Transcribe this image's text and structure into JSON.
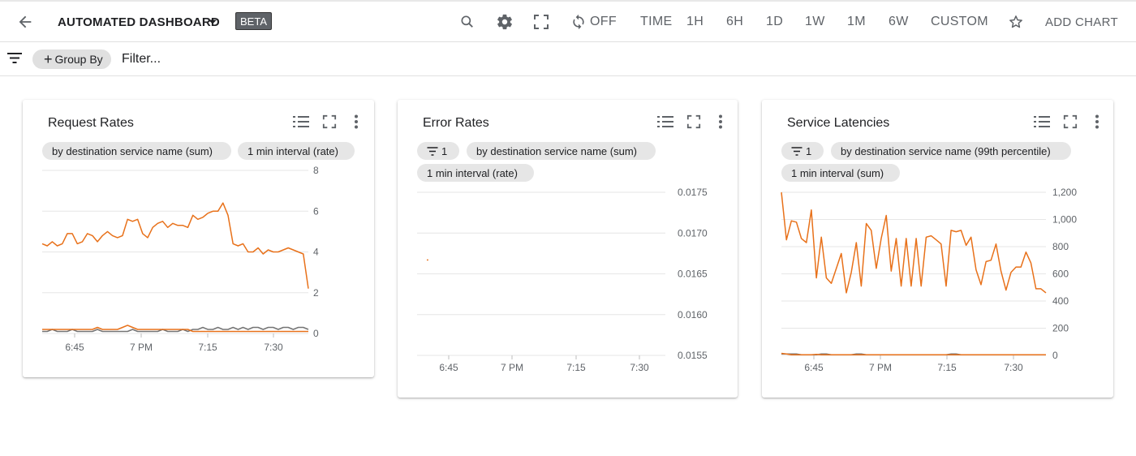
{
  "toolbar": {
    "title": "AUTOMATED DASHBOARD",
    "badge": "BETA",
    "refresh_label": "OFF",
    "time_label": "TIME",
    "ranges": [
      "1H",
      "6H",
      "1D",
      "1W",
      "1M",
      "6W",
      "CUSTOM"
    ],
    "add_chart_label": "ADD CHART",
    "icons": [
      "back-arrow-icon",
      "caret-down-icon",
      "search-icon",
      "gear-icon",
      "fullscreen-icon",
      "refresh-icon",
      "star-icon"
    ]
  },
  "filterbar": {
    "group_by_label": "Group By",
    "filter_placeholder": "Filter..."
  },
  "cards": [
    {
      "title": "Request Rates",
      "chips": [
        "by destination service name (sum)",
        "1 min interval (rate)"
      ]
    },
    {
      "title": "Error Rates",
      "filter_chip": "1",
      "chips": [
        "by destination service name (sum)",
        "1 min interval (rate)"
      ]
    },
    {
      "title": "Service Latencies",
      "filter_chip": "1",
      "chips": [
        "by destination service name (99th percentile)",
        "1 min interval (sum)"
      ]
    }
  ],
  "chart_data": [
    {
      "type": "line",
      "title": "Request Rates",
      "x_ticks": [
        "6:45",
        "7 PM",
        "7:15",
        "7:30"
      ],
      "y_ticks": [
        "0",
        "2",
        "4",
        "6",
        "8"
      ],
      "ylim": [
        0,
        8
      ],
      "grid": true,
      "series": [
        {
          "color": "#e8711a",
          "values": [
            4.4,
            4.3,
            4.5,
            4.3,
            4.4,
            4.9,
            4.9,
            4.4,
            4.5,
            4.9,
            4.8,
            4.5,
            4.8,
            5.0,
            4.8,
            4.7,
            4.8,
            5.6,
            5.5,
            5.6,
            4.9,
            4.7,
            5.2,
            5.4,
            5.5,
            5.2,
            5.4,
            5.3,
            5.3,
            5.2,
            5.8,
            5.6,
            5.7,
            5.9,
            6.0,
            6.0,
            6.4,
            5.8,
            4.4,
            4.3,
            4.4,
            4.0,
            4.0,
            4.2,
            3.9,
            4.1,
            4.0,
            4.0,
            4.1,
            4.2,
            4.1,
            4.0,
            3.9,
            2.2
          ]
        },
        {
          "color": "#757575",
          "values": [
            0.1,
            0.1,
            0.2,
            0.1,
            0.1,
            0.1,
            0.2,
            0.1,
            0.1,
            0.1,
            0.1,
            0.2,
            0.1,
            0.1,
            0.1,
            0.1,
            0.1,
            0.1,
            0.2,
            0.1,
            0.1,
            0.1,
            0.1,
            0.1,
            0.2,
            0.1,
            0.1,
            0.1,
            0.2,
            0.1,
            0.2,
            0.2,
            0.3,
            0.2,
            0.2,
            0.3,
            0.2,
            0.2,
            0.3,
            0.2,
            0.3,
            0.2,
            0.3,
            0.3,
            0.2,
            0.3,
            0.3,
            0.2,
            0.3,
            0.3,
            0.2,
            0.3,
            0.3,
            0.2
          ]
        },
        {
          "color": "#e8711a",
          "values": [
            0.2,
            0.2,
            0.2,
            0.2,
            0.2,
            0.2,
            0.2,
            0.2,
            0.2,
            0.2,
            0.2,
            0.3,
            0.2,
            0.2,
            0.2,
            0.2,
            0.3,
            0.4,
            0.3,
            0.2,
            0.2,
            0.2,
            0.2,
            0.2,
            0.2,
            0.2,
            0.2,
            0.2,
            0.2,
            0.2,
            0.1,
            0.1,
            0.1,
            0.1,
            0.1,
            0.1,
            0.1,
            0.1,
            0.1,
            0.1,
            0.1,
            0.1,
            0.1,
            0.1,
            0.1,
            0.1,
            0.1,
            0.1,
            0.1,
            0.1,
            0.1,
            0.1,
            0.1,
            0.1
          ]
        }
      ]
    },
    {
      "type": "line",
      "title": "Error Rates",
      "x_ticks": [
        "6:45",
        "7 PM",
        "7:15",
        "7:30"
      ],
      "y_ticks": [
        "0.0155",
        "0.0160",
        "0.0165",
        "0.0170",
        "0.0175"
      ],
      "ylim": [
        0.0155,
        0.0175
      ],
      "grid": true,
      "series": [
        {
          "color": "#e8711a",
          "points": [
            [
              0.0,
              0.01667
            ],
            [
              0.2,
              0.01667
            ]
          ]
        }
      ]
    },
    {
      "type": "line",
      "title": "Service Latencies",
      "x_ticks": [
        "6:45",
        "7 PM",
        "7:15",
        "7:30"
      ],
      "y_ticks": [
        "0",
        "200",
        "400",
        "600",
        "800",
        "1,000",
        "1,200"
      ],
      "ylim": [
        0,
        1200
      ],
      "grid": true,
      "series": [
        {
          "color": "#e8711a",
          "values": [
            1200,
            850,
            990,
            980,
            860,
            830,
            1070,
            570,
            870,
            570,
            530,
            640,
            750,
            460,
            610,
            830,
            510,
            970,
            920,
            640,
            860,
            1030,
            620,
            860,
            510,
            860,
            510,
            860,
            510,
            870,
            880,
            850,
            820,
            510,
            920,
            910,
            920,
            810,
            870,
            630,
            520,
            690,
            700,
            820,
            620,
            480,
            610,
            650,
            650,
            760,
            680,
            490,
            490,
            460
          ]
        },
        {
          "color": "#757575",
          "values": [
            10,
            10,
            10,
            10,
            5,
            5,
            5,
            5,
            10,
            10,
            5,
            5,
            5,
            5,
            5,
            10,
            10,
            5,
            5,
            5,
            5,
            5,
            5,
            5,
            5,
            5,
            5,
            5,
            5,
            5,
            5,
            5,
            5,
            5,
            10,
            10,
            5,
            5,
            5,
            5,
            5,
            5,
            5,
            5,
            5,
            5,
            5,
            5,
            5,
            5,
            5,
            5,
            5,
            5
          ]
        },
        {
          "color": "#e8711a",
          "values": [
            15,
            10,
            5,
            5,
            5,
            5,
            5,
            8,
            5,
            5,
            5,
            5,
            5,
            5,
            5,
            5,
            5,
            5,
            5,
            5,
            5,
            5,
            5,
            5,
            5,
            5,
            5,
            5,
            5,
            5,
            5,
            5,
            5,
            5,
            5,
            5,
            5,
            5,
            5,
            5,
            5,
            5,
            5,
            5,
            5,
            5,
            5,
            5,
            5,
            5,
            5,
            5,
            5,
            5
          ]
        }
      ]
    }
  ]
}
